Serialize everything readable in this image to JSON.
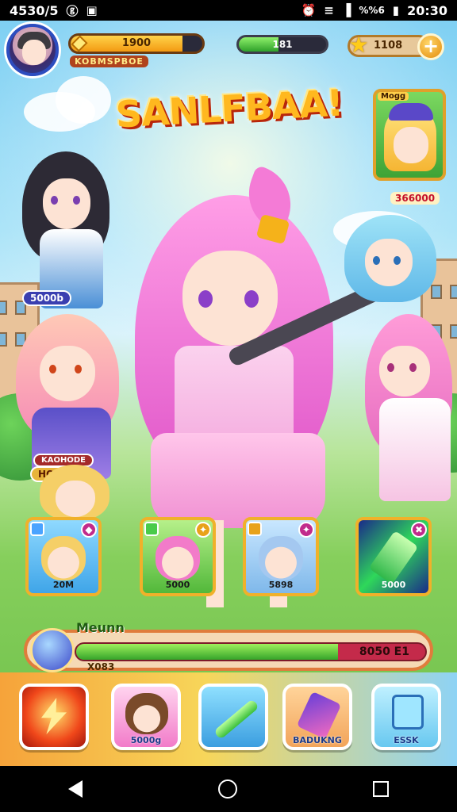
{
  "status_bar": {
    "left_text": "4530/5",
    "time": "20:30",
    "signal_label": "%%6"
  },
  "hud": {
    "level_value": "1900",
    "player_name": "KOBMSPBOE",
    "level_progress": 0.85,
    "energy_value": "181",
    "energy_progress": 0.45,
    "gold_value": "1108",
    "plus_label": "+"
  },
  "title": "SANLFBAA!",
  "featured_hero": {
    "tag": "Mogg",
    "price": "366000"
  },
  "side_characters": [
    {
      "label": "5000b"
    },
    {
      "label": "HOHAAK",
      "sublabel": "KAOHODE"
    }
  ],
  "character_cards": [
    {
      "value": "20M"
    },
    {
      "value": "5000"
    },
    {
      "value": "5898"
    },
    {
      "value": "5000"
    }
  ],
  "progress": {
    "title": "Meunn",
    "subtitle": "X083",
    "value_text": "8050 E1",
    "fill": 0.75
  },
  "menu": [
    {
      "label": ""
    },
    {
      "label": "5000g"
    },
    {
      "label": ""
    },
    {
      "label": "BADUKNG"
    },
    {
      "label": "ESSK"
    }
  ],
  "colors": {
    "accent": "#f39a12",
    "energy": "#2ea12a",
    "menu_border": "#ffffff"
  }
}
